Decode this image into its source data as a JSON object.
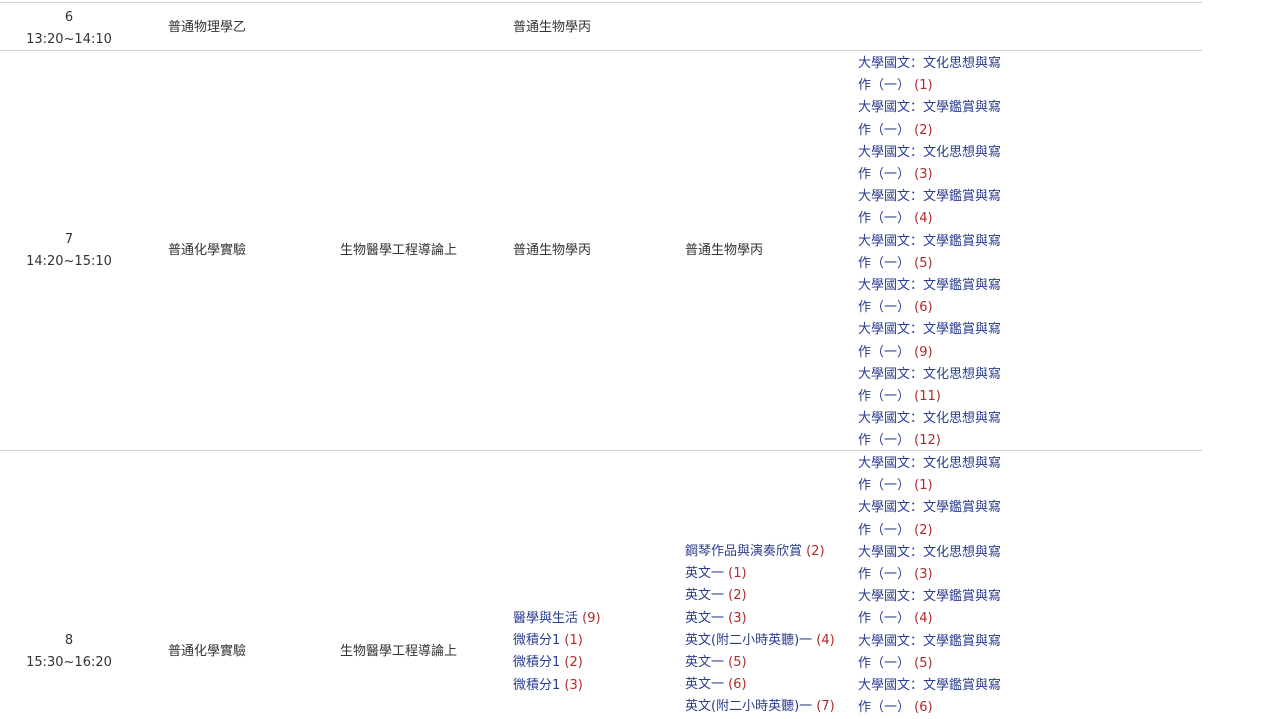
{
  "rows": [
    {
      "period": "6",
      "time": "13:20~14:10",
      "col1": "普通物理學乙",
      "col2": "",
      "col3": "普通生物學丙",
      "col4": "",
      "col5": []
    },
    {
      "period": "7",
      "time": "14:20~15:10",
      "col1": "普通化學實驗",
      "col2": "生物醫學工程導論上",
      "col3": "普通生物學丙",
      "col4": "普通生物學丙",
      "col5": [
        {
          "a": "大學國文：文化思想與寫",
          "b": "作（一）",
          "n": "(1)"
        },
        {
          "a": "大學國文：文學鑑賞與寫",
          "b": "作（一）",
          "n": "(2)"
        },
        {
          "a": "大學國文：文化思想與寫",
          "b": "作（一）",
          "n": "(3)"
        },
        {
          "a": "大學國文：文學鑑賞與寫",
          "b": "作（一）",
          "n": "(4)"
        },
        {
          "a": "大學國文：文學鑑賞與寫",
          "b": "作（一）",
          "n": "(5)"
        },
        {
          "a": "大學國文：文學鑑賞與寫",
          "b": "作（一）",
          "n": "(6)"
        },
        {
          "a": "大學國文：文學鑑賞與寫",
          "b": "作（一）",
          "n": "(9)"
        },
        {
          "a": "大學國文：文化思想與寫",
          "b": "作（一）",
          "n": "(11)"
        },
        {
          "a": "大學國文：文化思想與寫",
          "b": "作（一）",
          "n": "(12)"
        }
      ]
    },
    {
      "period": "8",
      "time": "15:30~16:20",
      "col1": "普通化學實驗",
      "col2": "生物醫學工程導論上",
      "col3_list": [
        {
          "name": "醫學與生活",
          "n": "(9)"
        },
        {
          "name": "微積分1",
          "n": "(1)"
        },
        {
          "name": "微積分1",
          "n": "(2)"
        },
        {
          "name": "微積分1",
          "n": "(3)"
        }
      ],
      "col4_list": [
        {
          "name": "鋼琴作品與演奏欣賞",
          "n": "(2)"
        },
        {
          "name": "英文一",
          "n": "(1)"
        },
        {
          "name": "英文一",
          "n": "(2)"
        },
        {
          "name": "英文一",
          "n": "(3)"
        },
        {
          "name": "英文(附二小時英聽)一",
          "n": "(4)"
        },
        {
          "name": "英文一",
          "n": "(5)"
        },
        {
          "name": "英文一",
          "n": "(6)"
        },
        {
          "name": "英文(附二小時英聽)一",
          "n": "(7)"
        }
      ],
      "col5": [
        {
          "a": "大學國文：文化思想與寫",
          "b": "作（一）",
          "n": "(1)"
        },
        {
          "a": "大學國文：文學鑑賞與寫",
          "b": "作（一）",
          "n": "(2)"
        },
        {
          "a": "大學國文：文化思想與寫",
          "b": "作（一）",
          "n": "(3)"
        },
        {
          "a": "大學國文：文學鑑賞與寫",
          "b": "作（一）",
          "n": "(4)"
        },
        {
          "a": "大學國文：文學鑑賞與寫",
          "b": "作（一）",
          "n": "(5)"
        },
        {
          "a": "大學國文：文學鑑賞與寫",
          "b": "作（一）",
          "n": "(6)"
        }
      ]
    }
  ]
}
